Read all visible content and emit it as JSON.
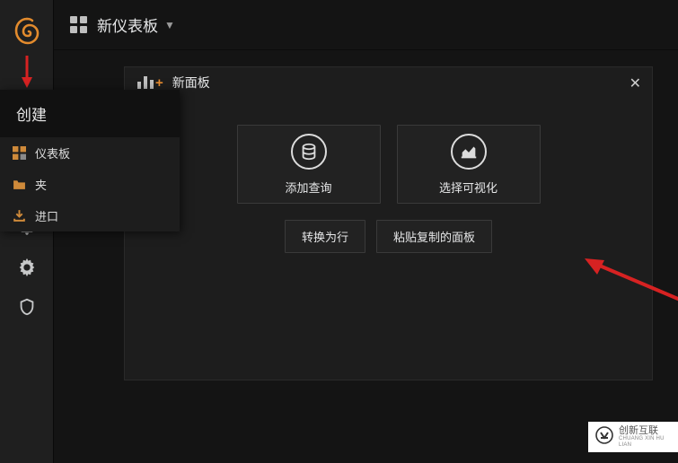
{
  "app": {
    "dashboard_title": "新仪表板"
  },
  "sidebar": {
    "items": [
      {
        "name": "logo"
      },
      {
        "name": "create",
        "active": true
      },
      {
        "name": "dashboards"
      },
      {
        "name": "explore"
      },
      {
        "name": "alerting"
      },
      {
        "name": "configuration"
      },
      {
        "name": "admin-shield"
      }
    ]
  },
  "flyout": {
    "header": "创建",
    "items": [
      {
        "label": "仪表板",
        "icon": "dashboard-icon"
      },
      {
        "label": "夹",
        "icon": "folder-icon"
      },
      {
        "label": "进口",
        "icon": "import-icon"
      }
    ]
  },
  "panel": {
    "title": "新面板",
    "cards": {
      "add_query": "添加查询",
      "choose_viz": "选择可视化"
    },
    "buttons": {
      "convert_row": "转换为行",
      "paste_panel": "粘贴复制的面板"
    }
  },
  "watermark": {
    "cn": "创新互联",
    "en": "CHUANG XIN HU LIAN"
  }
}
